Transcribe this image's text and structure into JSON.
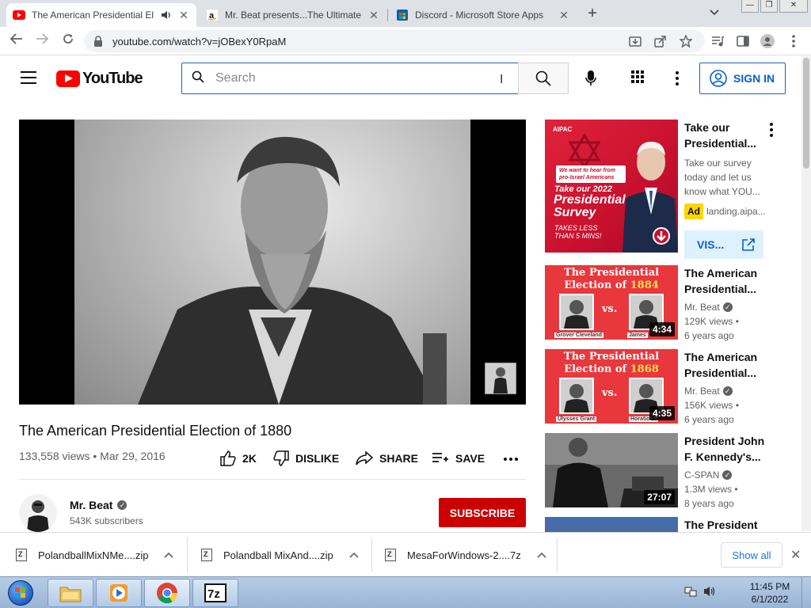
{
  "browser": {
    "tabs": [
      {
        "title": "The American Presidential El",
        "favicon": "youtube-favicon",
        "active": true
      },
      {
        "title": "Mr. Beat presents...The Ultimate",
        "favicon": "amazon-favicon",
        "active": false
      },
      {
        "title": "Discord - Microsoft Store Apps",
        "favicon": "store-favicon",
        "active": false
      }
    ],
    "new_tab": "+",
    "url": "youtube.com/watch?v=jOBexY0RpaM"
  },
  "youtube": {
    "logo_text": "YouTube",
    "search_placeholder": "Search",
    "sign_in": "SIGN IN"
  },
  "video": {
    "title": "The American Presidential Election of 1880",
    "meta": "133,558 views • Mar 29, 2016",
    "likes": "2K",
    "dislike": "DISLIKE",
    "share": "SHARE",
    "save": "SAVE",
    "channel": "Mr. Beat",
    "subscribers": "543K subscribers",
    "subscribe": "SUBSCRIBE"
  },
  "ad": {
    "title": "Take our Presidential...",
    "desc": "Take our survey today and let us know what YOU...",
    "badge": "Ad",
    "domain": "landing.aipa...",
    "visit": "VIS...",
    "thumb": {
      "brand": "AIPAC",
      "bubble": "We want to hear from pro-Israel Americans",
      "line1": "Take our 2022",
      "line2": "Presidential Survey",
      "line3": "TAKES LESS THAN 5 MINS!"
    }
  },
  "related": [
    {
      "title": "The American Presidential...",
      "channel": "Mr. Beat",
      "views": "129K views •",
      "age": "6 years ago",
      "duration": "4:34",
      "thumb_header_1": "The Presidential",
      "thumb_header_2": "Election of",
      "thumb_year": "1884",
      "vs": "vs.",
      "left_name": "Grover Cleveland",
      "right_name": "James"
    },
    {
      "title": "The American Presidential...",
      "channel": "Mr. Beat",
      "views": "156K views •",
      "age": "6 years ago",
      "duration": "4:35",
      "thumb_header_1": "The Presidential",
      "thumb_header_2": "Election of",
      "thumb_year": "1868",
      "vs": "vs.",
      "left_name": "Ulysses Grant",
      "right_name": "Horatio S."
    },
    {
      "title": "President John F. Kennedy's...",
      "channel": "C-SPAN",
      "views": "1.3M views •",
      "age": "8 years ago",
      "duration": "27:07"
    },
    {
      "title": "The President"
    }
  ],
  "downloads": {
    "items": [
      "PolandballMixNMe....zip",
      "Polandball MixAnd....zip",
      "MesaForWindows-2....7z"
    ],
    "show_all": "Show all"
  },
  "taskbar": {
    "time": "11:45 PM",
    "date": "6/1/2022"
  },
  "colors": {
    "youtube_red": "#ff0000",
    "subscribe_red": "#cc0000",
    "link_blue": "#065fd4",
    "ad_yellow": "#ffd600"
  }
}
